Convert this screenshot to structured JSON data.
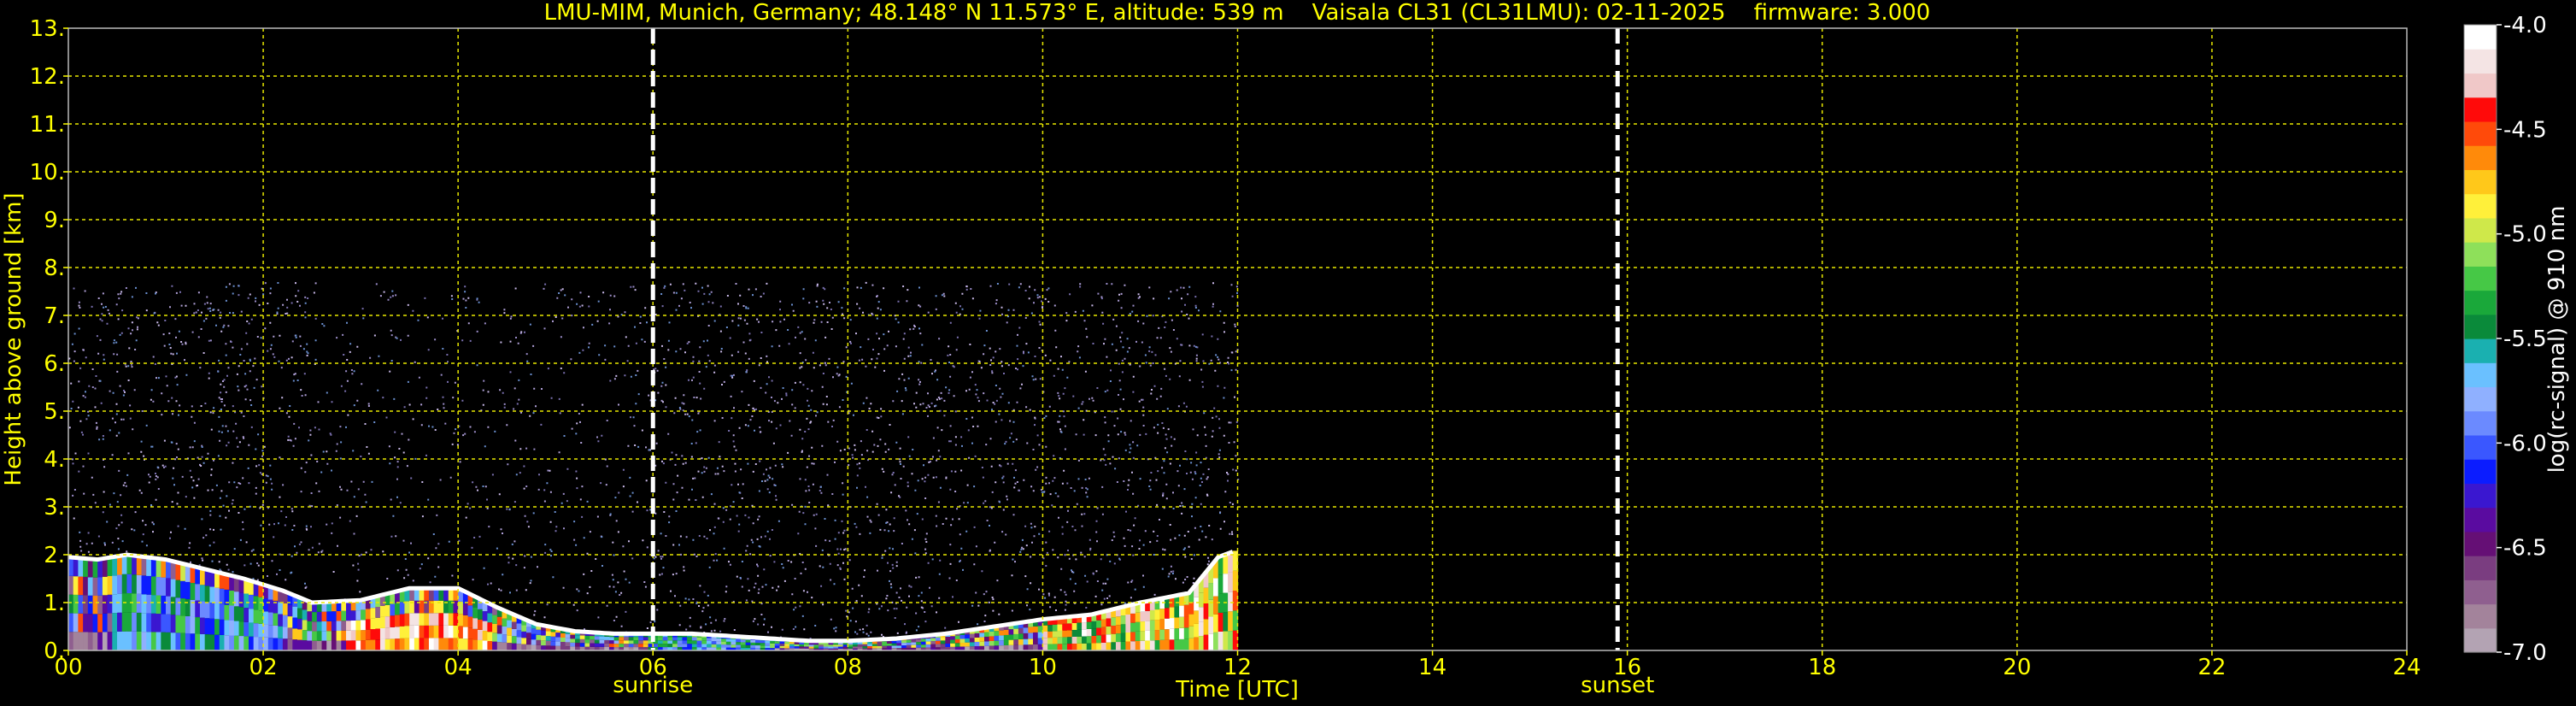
{
  "chart_data": {
    "type": "heatmap",
    "title": "LMU-MIM, Munich, Germany; 48.148° N 11.573° E, altitude: 539 m    Vaisala CL31 (CL31LMU): 02-11-2025    firmware: 3.000",
    "xlabel": "Time [UTC]",
    "ylabel": "Height above ground [km]",
    "xlim": [
      0,
      24
    ],
    "ylim": [
      0,
      13
    ],
    "x_ticks": [
      "00",
      "02",
      "04",
      "06",
      "08",
      "10",
      "12",
      "14",
      "16",
      "18",
      "20",
      "22",
      "24"
    ],
    "y_ticks": [
      "0.",
      "1.",
      "2.",
      "3.",
      "4.",
      "5.",
      "6.",
      "7.",
      "8.",
      "9.",
      "10.",
      "11.",
      "12.",
      "13."
    ],
    "grid": true,
    "data_extent": {
      "time_start": 0,
      "time_end": 12,
      "max_height_km": 7.7
    },
    "events": [
      {
        "label": "sunrise",
        "time": 6.0
      },
      {
        "label": "sunset",
        "time": 15.9
      }
    ],
    "boundary_layer_top": {
      "x": [
        0,
        0.3,
        0.6,
        1.0,
        1.4,
        1.8,
        2.2,
        2.5,
        3.0,
        3.5,
        4.0,
        4.4,
        4.8,
        5.2,
        5.6,
        6.0,
        6.4,
        6.8,
        7.2,
        7.6,
        8.0,
        8.5,
        9.0,
        9.5,
        10.0,
        10.5,
        11.0,
        11.5,
        11.8,
        12.0
      ],
      "y": [
        1.95,
        1.9,
        2.0,
        1.9,
        1.7,
        1.5,
        1.25,
        1.0,
        1.05,
        1.3,
        1.3,
        0.9,
        0.55,
        0.4,
        0.35,
        0.35,
        0.35,
        0.3,
        0.25,
        0.2,
        0.2,
        0.25,
        0.35,
        0.5,
        0.65,
        0.75,
        1.0,
        1.2,
        1.95,
        2.1
      ]
    },
    "colorbar": {
      "label": "log(rc-signal) @ 910 nm",
      "range": [
        -7.0,
        -4.0
      ],
      "ticks": [
        "-4.0",
        "-4.5",
        "-5.0",
        "-5.5",
        "-6.0",
        "-6.5",
        "-7.0"
      ],
      "colors": [
        "#b3a3b3",
        "#a3839b",
        "#8f5f8f",
        "#7a3d80",
        "#650f75",
        "#5a0ba0",
        "#3a17d0",
        "#0b1cff",
        "#3a57ff",
        "#6b8aff",
        "#8fb0ff",
        "#6ac0ff",
        "#1ab0b0",
        "#0a8a3a",
        "#1aa83a",
        "#46c846",
        "#8ee05a",
        "#cfe84a",
        "#fff03a",
        "#ffc81a",
        "#ff8a0a",
        "#ff4a0a",
        "#ff0a0a",
        "#f0c8c8",
        "#f4e4e4",
        "#ffffff"
      ]
    }
  }
}
